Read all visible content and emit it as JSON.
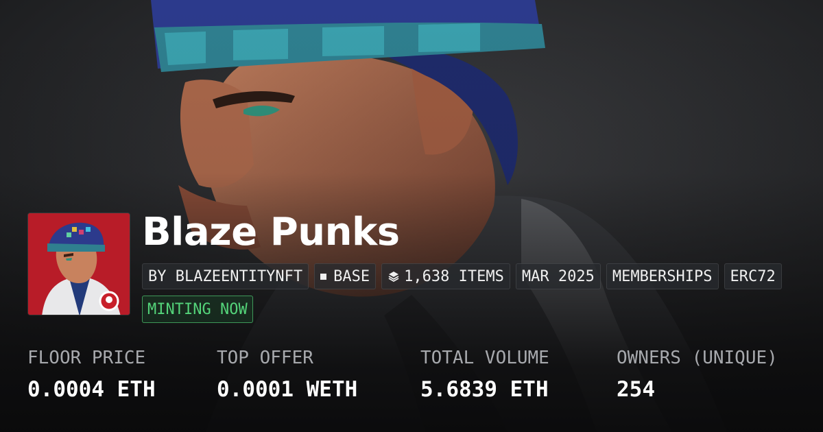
{
  "collection": {
    "name": "Blaze Punks",
    "tags": [
      {
        "label": "BY BLAZEENTITYNFT",
        "icon": "none"
      },
      {
        "label": "BASE",
        "icon": "square-icon"
      },
      {
        "label": "1,638 ITEMS",
        "icon": "layers-icon"
      },
      {
        "label": "MAR 2025",
        "icon": "none"
      },
      {
        "label": "MEMBERSHIPS",
        "icon": "none"
      },
      {
        "label": "ERC72",
        "icon": "none"
      }
    ],
    "status_badge": "MINTING NOW"
  },
  "stats": [
    {
      "label": "FLOOR PRICE",
      "value": "0.0004 ETH"
    },
    {
      "label": "TOP OFFER",
      "value": "0.0001 WETH"
    },
    {
      "label": "TOTAL VOLUME",
      "value": "5.6839 ETH"
    },
    {
      "label": "OWNERS (UNIQUE)",
      "value": "254"
    }
  ],
  "colors": {
    "background": "#1c1d1f",
    "minting_green": "#54d47a",
    "thumbnail_bg": "#c8202c"
  }
}
